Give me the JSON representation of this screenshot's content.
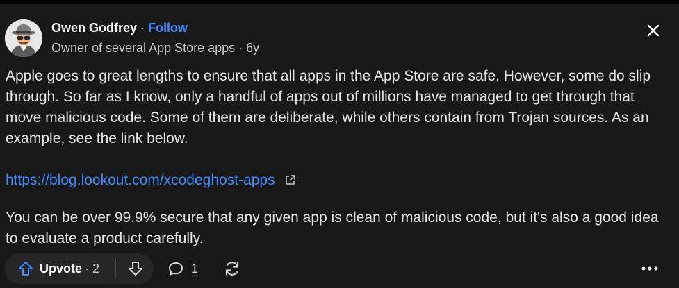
{
  "answer": {
    "author": "Owen Godfrey",
    "separator": "·",
    "follow_label": "Follow",
    "credential": "Owner of several App Store apps · 6y",
    "paragraphs": [
      "Apple goes to great lengths to ensure that all apps in the App Store are safe. However, some do slip through. So far as I know, only a handful of apps out of millions have managed to get through that move malicious code. Some of them are deliberate, while others contain from Trojan sources. As an example, see the link below.",
      "You can be over 99.9% secure that any given app is clean of malicious code, but it's also a good idea to evaluate a product carefully."
    ],
    "link_text": "https://blog.lookout.com/xcodeghost-apps"
  },
  "actions": {
    "upvote_label": "Upvote",
    "upvote_count": "· 2",
    "comment_count": "1"
  },
  "colors": {
    "background": "#181818",
    "link": "#3b8cff",
    "text": "#e6e6e6"
  },
  "icons": [
    "avatar-spy-icon",
    "close-icon",
    "external-link-icon",
    "upvote-arrow-icon",
    "downvote-arrow-icon",
    "comment-icon",
    "share-icon",
    "more-icon"
  ]
}
